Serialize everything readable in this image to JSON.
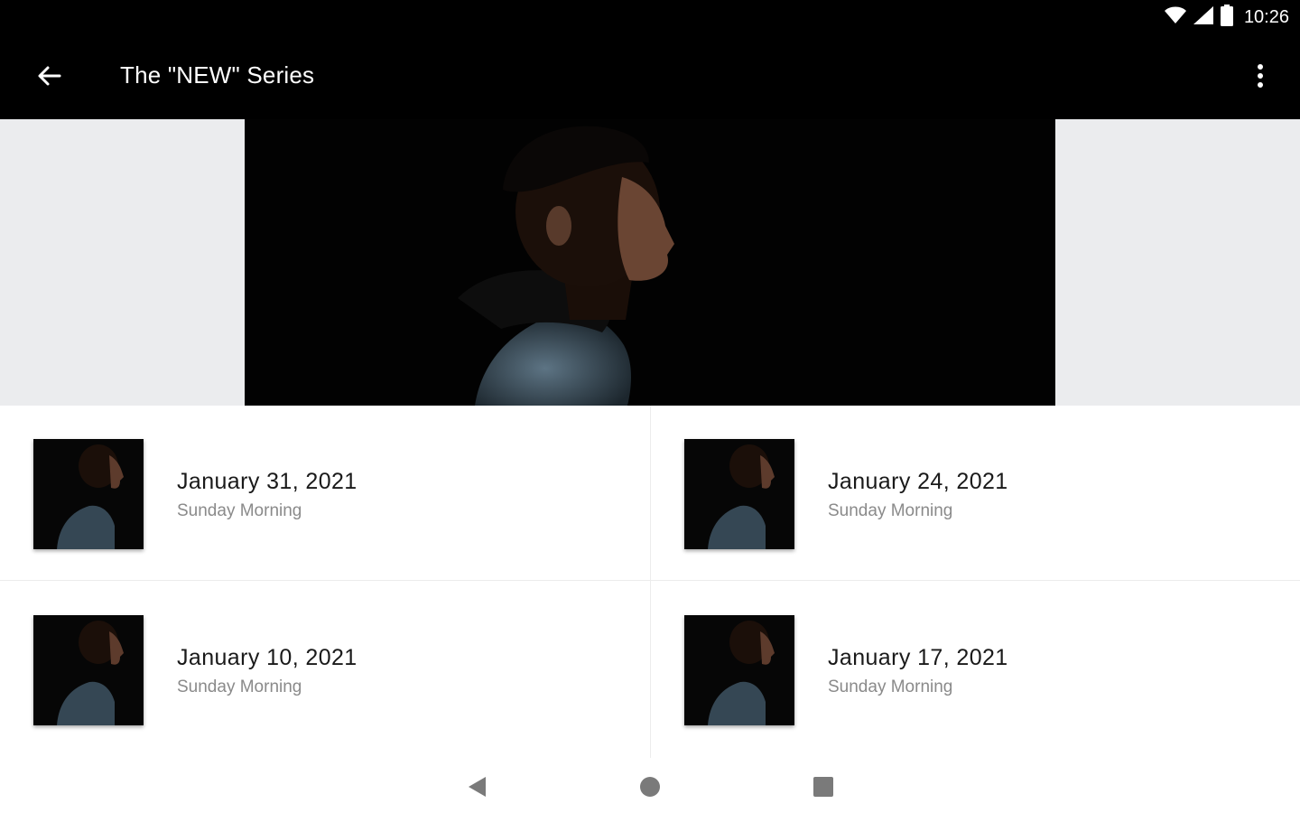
{
  "status_bar": {
    "time": "10:26",
    "icons": [
      "wifi-icon",
      "signal-icon",
      "battery-icon"
    ]
  },
  "app_bar": {
    "title": "The \"NEW\" Series",
    "back_icon": "arrow-back-icon",
    "menu_icon": "more-vert-icon"
  },
  "hero": {
    "image": "series-artwork-man-profile"
  },
  "items": [
    {
      "title": "January 31, 2021",
      "subtitle": "Sunday Morning"
    },
    {
      "title": "January 24, 2021",
      "subtitle": "Sunday Morning"
    },
    {
      "title": "January 10, 2021",
      "subtitle": "Sunday Morning"
    },
    {
      "title": "January 17, 2021",
      "subtitle": "Sunday Morning"
    }
  ],
  "nav_bar": {
    "back": "nav-back-icon",
    "home": "nav-home-icon",
    "recents": "nav-recents-icon"
  },
  "colors": {
    "app_bar": "#000000",
    "hero_band": "#ebecee",
    "title_text": "#1a1a1a",
    "subtitle_text": "#8a8a8a"
  }
}
